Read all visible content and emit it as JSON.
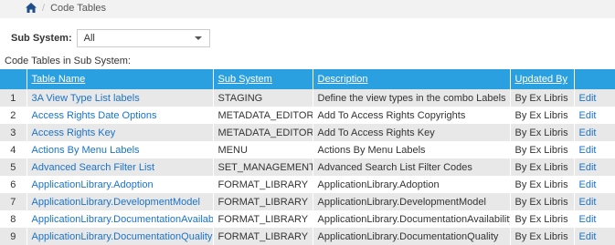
{
  "breadcrumb": {
    "current": "Code Tables"
  },
  "filter": {
    "label": "Sub System:",
    "value": "All"
  },
  "section": {
    "title": "Code Tables in Sub System:"
  },
  "table": {
    "headers": {
      "name": "Table Name",
      "subsystem": "Sub System",
      "description": "Description",
      "updated_by": "Updated By"
    },
    "rows": [
      {
        "num": "1",
        "name": "3A View Type List labels",
        "subsystem": "STAGING",
        "description": "Define the view types in the combo Labels",
        "updated_by": "By Ex Libris",
        "action": "Edit"
      },
      {
        "num": "2",
        "name": "Access Rights Date Options",
        "subsystem": "METADATA_EDITOR",
        "description": "Add To Access Rights Copyrights",
        "updated_by": "By Ex Libris",
        "action": "Edit"
      },
      {
        "num": "3",
        "name": "Access Rights Key",
        "subsystem": "METADATA_EDITOR",
        "description": "Add To Access Rights Key",
        "updated_by": "By Ex Libris",
        "action": "Edit"
      },
      {
        "num": "4",
        "name": "Actions By Menu Labels",
        "subsystem": "MENU",
        "description": "Actions By Menu Labels",
        "updated_by": "By Ex Libris",
        "action": "Edit"
      },
      {
        "num": "5",
        "name": "Advanced Search Filter List",
        "subsystem": "SET_MANAGEMENT",
        "description": "Advanced Search List Filter Codes",
        "updated_by": "By Ex Libris",
        "action": "Edit"
      },
      {
        "num": "6",
        "name": "ApplicationLibrary.Adoption",
        "subsystem": "FORMAT_LIBRARY",
        "description": "ApplicationLibrary.Adoption",
        "updated_by": "By Ex Libris",
        "action": "Edit"
      },
      {
        "num": "7",
        "name": "ApplicationLibrary.DevelopmentModel",
        "subsystem": "FORMAT_LIBRARY",
        "description": "ApplicationLibrary.DevelopmentModel",
        "updated_by": "By Ex Libris",
        "action": "Edit"
      },
      {
        "num": "8",
        "name": "ApplicationLibrary.DocumentationAvailability",
        "subsystem": "FORMAT_LIBRARY",
        "description": "ApplicationLibrary.DocumentationAvailability",
        "updated_by": "By Ex Libris",
        "action": "Edit"
      },
      {
        "num": "9",
        "name": "ApplicationLibrary.DocumentationQuality",
        "subsystem": "FORMAT_LIBRARY",
        "description": "ApplicationLibrary.DocumentationQuality",
        "updated_by": "By Ex Libris",
        "action": "Edit"
      }
    ]
  },
  "colors": {
    "header_bg": "#2aa0e0",
    "link": "#1a73c9",
    "row_alt": "#e8e8e8"
  },
  "icons": {
    "home": "home-icon",
    "dropdown": "chevron-down-icon"
  }
}
